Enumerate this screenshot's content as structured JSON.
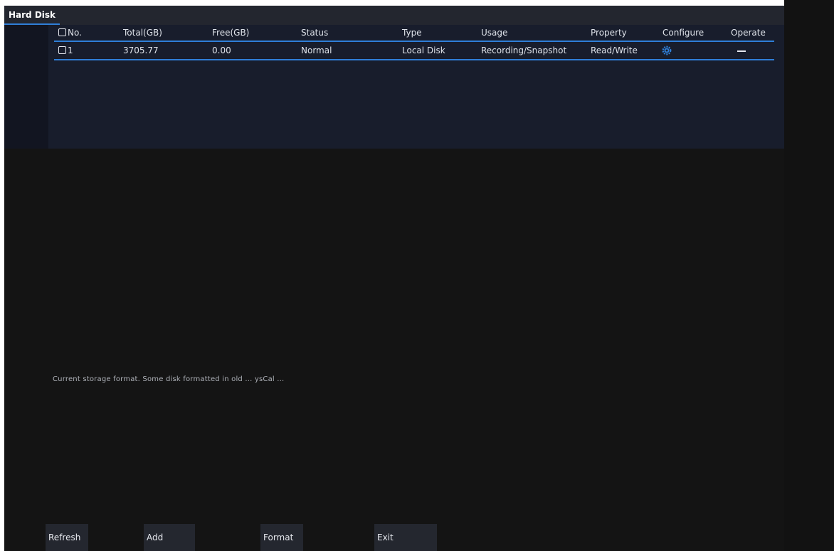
{
  "window": {
    "title": "Hard Disk"
  },
  "table": {
    "columns": [
      "No.",
      "Total(GB)",
      "Free(GB)",
      "Status",
      "Type",
      "Usage",
      "Property",
      "Configure",
      "Operate"
    ],
    "rows": [
      {
        "no": "1",
        "total": "3705.77",
        "free": "0.00",
        "status": "Normal",
        "type": "Local Disk",
        "usage": "Recording/Snapshot",
        "property": "Read/Write",
        "configure_icon": "gear-icon",
        "operate": "—"
      }
    ]
  },
  "status_message": "Current storage format. Some disk formatted in old ... ysCal ...",
  "buttons": {
    "refresh": "Refresh",
    "add": "Add",
    "format": "Format",
    "exit": "Exit"
  },
  "colors": {
    "accent": "#2f7fd8",
    "background": "#141414",
    "panel": "#181d2c"
  }
}
